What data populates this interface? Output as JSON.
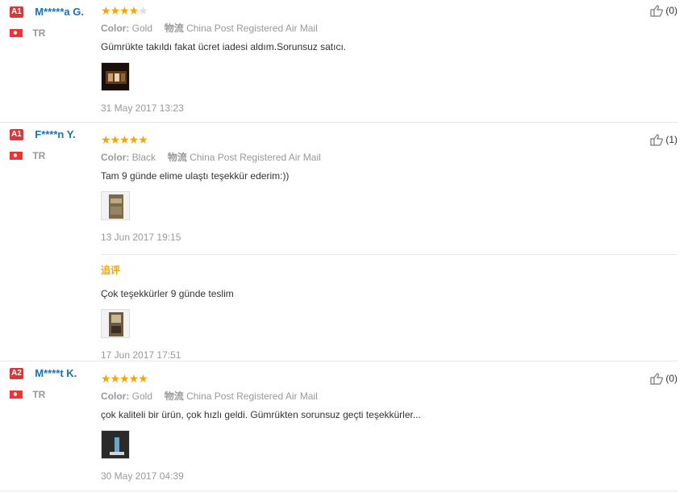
{
  "reviews": [
    {
      "badge": "A1",
      "badge_color": "#d9383a",
      "name": "M*****a G.",
      "country": "TR",
      "rating": 4,
      "color_label": "Color:",
      "color_value": "Gold",
      "shipping_label": "物流",
      "shipping_value": "China Post Registered Air Mail",
      "text": "Gümrükte takıldı fakat ücret iadesi aldım.Sorunsuz satıcı.",
      "date": "31 May 2017 13:23",
      "helpful_count": "(0)",
      "image": "dark-interior-photo"
    },
    {
      "badge": "A1",
      "badge_color": "#d9383a",
      "name": "F****n Y.",
      "country": "TR",
      "rating": 5,
      "color_label": "Color:",
      "color_value": "Black",
      "shipping_label": "物流",
      "shipping_value": "China Post Registered Air Mail",
      "text": "Tam 9 günde elime ulaştı teşekkür ederim:))",
      "date": "13 Jun 2017 19:15",
      "helpful_count": "(1)",
      "image": "package-photo",
      "followup": {
        "label": "追评",
        "text": "Çok teşekkürler 9 günde teslim",
        "date": "17 Jun 2017 17:51",
        "image": "product-photo"
      }
    },
    {
      "badge": "A2",
      "badge_color": "#d9383a",
      "name": "M****t K.",
      "country": "TR",
      "rating": 5,
      "color_label": "Color:",
      "color_value": "Gold",
      "shipping_label": "物流",
      "shipping_value": "China Post Registered Air Mail",
      "text": "çok kaliteli bir ürün, çok hızlı geldi. Gümrükten sorunsuz geçti teşekkürler...",
      "date": "30 May 2017 04:39",
      "helpful_count": "(0)",
      "image": "blue-light-photo"
    }
  ]
}
